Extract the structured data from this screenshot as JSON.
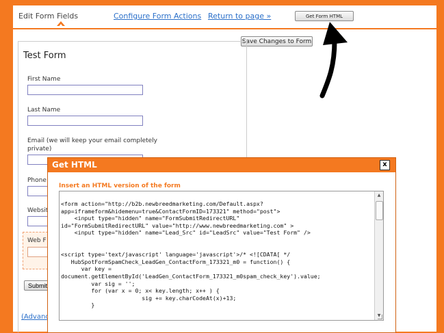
{
  "tabs": {
    "active": "Edit Form Fields",
    "configure": "Configure Form Actions",
    "return": "Return to page »",
    "get_html_button": "Get Form HTML"
  },
  "save_button": "Save Changes to Form",
  "form": {
    "title": "Test Form",
    "fields": [
      "First Name",
      "Last Name",
      "Email (we will keep your email completely private)",
      "Phone",
      "Website",
      "Web F"
    ],
    "submit": "Submit",
    "advanced": "(Advanced)"
  },
  "modal": {
    "title": "Get HTML",
    "close": "x",
    "subtitle": "Insert an HTML version of the form",
    "code_lines": [
      "<form action=\"http://b2b.newbreedmarketing.com/Default.aspx?",
      "app=iframeform&hidemenu=true&ContactFormID=173321\" method=\"post\">",
      "    <input type=\"hidden\" name=\"FormSubmitRedirectURL\"",
      "id=\"FormSubmitRedirectURL\" value=\"http://www.newbreedmarketing.com\" >",
      "    <input type=\"hidden\" name=\"Lead_Src\" id=\"LeadSrc\" value=\"Test Form\" />",
      "",
      "",
      "<script type='text/javascript' language='javascript'>/* <![CDATA[ */",
      "   HubSpotFormSpamCheck_LeadGen_ContactForm_173321_m0 = function() {",
      "      var key =",
      "document.getElementById('LeadGen_ContactForm_173321_m0spam_check_key').value;",
      "         var sig = '';",
      "         for (var x = 0; x< key.length; x++ ) {",
      "                        sig += key.charCodeAt(x)+13;",
      "         }"
    ]
  },
  "colors": {
    "accent": "#f47920",
    "link": "#2a6fc9"
  }
}
